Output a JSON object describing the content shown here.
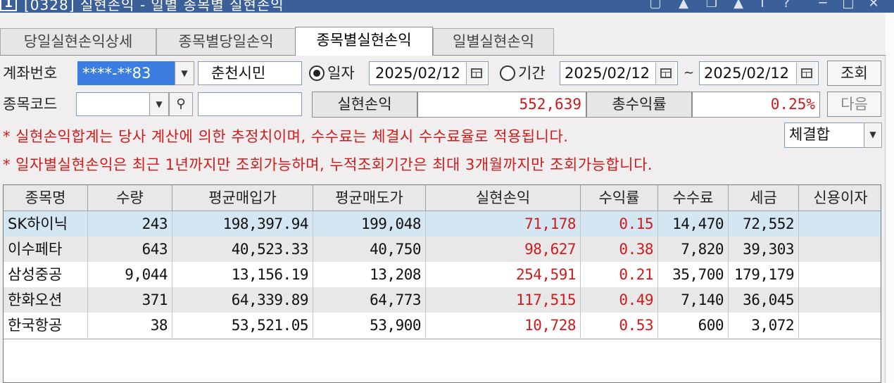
{
  "window": {
    "number": "1",
    "title": "[0328] 실현손익 - 일별 종목별 실현손익",
    "controls": [
      "pin-icon",
      "arrow-up-icon",
      "copy-icon",
      "bell-icon",
      "info-icon",
      "help-icon",
      "minimize-icon",
      "maximize-icon",
      "close-icon"
    ],
    "controls_text": {
      "info": "I",
      "help": "?",
      "close": "✕"
    }
  },
  "tabs": [
    {
      "label": "당일실현손익상세",
      "active": false
    },
    {
      "label": "종목별당일손익",
      "active": false
    },
    {
      "label": "종목별실현손익",
      "active": true
    },
    {
      "label": "일별실현손익",
      "active": false
    }
  ],
  "query": {
    "account_label": "계좌번호",
    "account_value": "****-**83",
    "account_name": "춘천시민",
    "radio_day_label": "일자",
    "radio_day_date": "2025/02/12",
    "radio_period_label": "기간",
    "period_from": "2025/02/12",
    "period_sep": "~",
    "period_to": "2025/02/12",
    "search_button": "조회",
    "stock_code_label": "종목코드",
    "stock_code_value": "",
    "stock_name_value": "",
    "realized_label": "실현손익",
    "realized_value": "552,639",
    "total_return_label": "총수익률",
    "total_return_value": "0.25%",
    "next_button": "다음",
    "filter_value": "체결합"
  },
  "notices": [
    "* 실현손익합계는 당사 계산에 의한 추정치이며, 수수료는 체결시 수수료율로 적용됩니다.",
    "* 일자별실현손익은 최근 1년까지만 조회가능하며, 누적조회기간은 최대 3개월까지만 조회가능합니다."
  ],
  "table": {
    "columns": [
      "종목명",
      "수량",
      "평균매입가",
      "평균매도가",
      "실현손익",
      "수익률",
      "수수료",
      "세금",
      "신용이자"
    ],
    "rows": [
      [
        "SK하이닉",
        "243",
        "198,397.94",
        "199,048",
        "71,178",
        "0.15",
        "14,470",
        "72,552",
        ""
      ],
      [
        "이수페타",
        "643",
        "40,523.33",
        "40,750",
        "98,627",
        "0.38",
        "7,820",
        "39,303",
        ""
      ],
      [
        "삼성중공",
        "9,044",
        "13,156.19",
        "13,208",
        "254,591",
        "0.21",
        "35,700",
        "179,179",
        ""
      ],
      [
        "한화오션",
        "371",
        "64,339.89",
        "64,773",
        "117,515",
        "0.49",
        "7,140",
        "36,045",
        ""
      ],
      [
        "한국항공",
        "38",
        "53,521.05",
        "53,900",
        "10,728",
        "0.53",
        "600",
        "3,072",
        ""
      ]
    ],
    "row_colors": [
      "#d4e6f2",
      "#e8e8e8",
      "#ffffff",
      "#e8e8e8",
      "#ffffff"
    ]
  },
  "colors": {
    "titlebar": "#3b5f98",
    "profit_red": "#d21a1a",
    "selection_blue": "#3b7de0"
  }
}
